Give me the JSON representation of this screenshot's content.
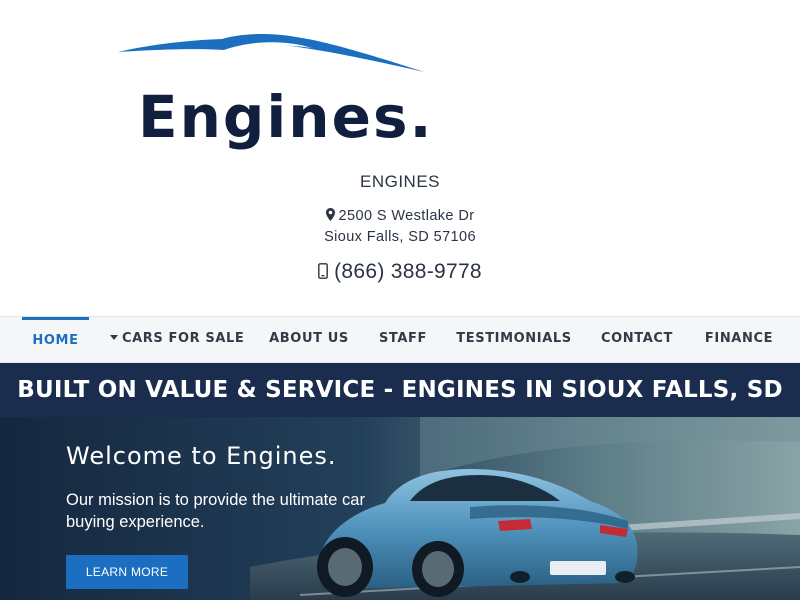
{
  "brand": {
    "logo_text": "Engines.",
    "logo_icon": "car-silhouette-swoosh",
    "accent_color": "#1c6fc0",
    "navy_color": "#0f1f3d"
  },
  "dealer": {
    "name": "ENGINES",
    "address_line1": "2500 S Westlake Dr",
    "address_line2": "Sioux Falls, SD 57106",
    "phone": "(866) 388-9778",
    "address_icon": "map-marker-icon",
    "phone_icon": "mobile-phone-icon"
  },
  "nav": {
    "items": [
      {
        "label": "HOME",
        "active": true
      },
      {
        "label": "CARS FOR SALE",
        "has_dropdown": true
      },
      {
        "label": "ABOUT US"
      },
      {
        "label": "STAFF"
      },
      {
        "label": "TESTIMONIALS"
      },
      {
        "label": "CONTACT"
      },
      {
        "label": "FINANCE"
      }
    ]
  },
  "banner": {
    "title": "BUILT ON VALUE & SERVICE - ENGINES IN SIOUX FALLS, SD",
    "background_color": "#1a2d4f"
  },
  "hero": {
    "heading": "Welcome to Engines.",
    "body": "Our mission is to provide the ultimate car buying experience.",
    "button_label": "LEARN MORE"
  }
}
